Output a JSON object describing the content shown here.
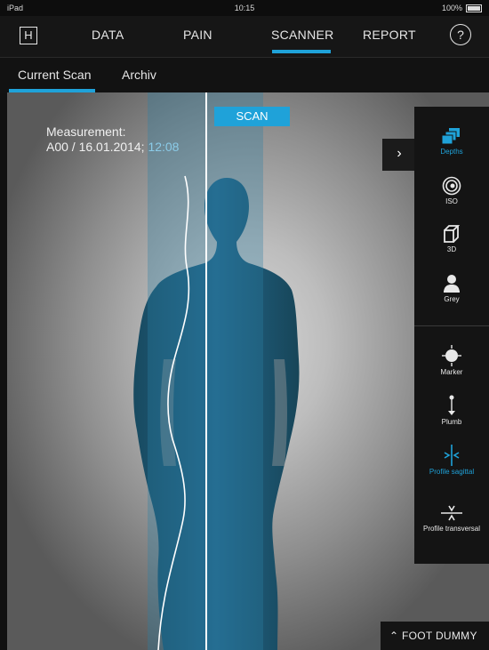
{
  "status_bar": {
    "device": "iPad",
    "time": "10:15",
    "battery": "100%"
  },
  "nav": {
    "logo": "H",
    "tabs": [
      {
        "label": "DATA"
      },
      {
        "label": "PAIN"
      },
      {
        "label": "SCANNER",
        "active": true
      },
      {
        "label": "REPORT"
      }
    ],
    "help": "?"
  },
  "subnav": {
    "tabs": [
      {
        "label": "Current Scan",
        "active": true
      },
      {
        "label": "Archiv"
      }
    ]
  },
  "scan": {
    "measurement_label": "Measurement:",
    "measurement_id": "A00 / 16.01.2014;",
    "measurement_time": "12:08",
    "scan_button": "SCAN"
  },
  "toolbar": {
    "expand": "›",
    "view_tools": [
      {
        "label": "Depths",
        "icon": "depths-icon",
        "active": true
      },
      {
        "label": "ISO",
        "icon": "iso-icon"
      },
      {
        "label": "3D",
        "icon": "cube-icon"
      },
      {
        "label": "Grey",
        "icon": "grey-person-icon"
      }
    ],
    "analysis_tools": [
      {
        "label": "Marker",
        "icon": "marker-icon"
      },
      {
        "label": "Plumb",
        "icon": "plumb-icon"
      },
      {
        "label": "Profile sagittal",
        "icon": "profile-sagittal-icon",
        "active": true
      },
      {
        "label": "Profile transversal",
        "icon": "profile-transversal-icon"
      }
    ]
  },
  "footer": {
    "foot_dummy": "FOOT DUMMY"
  },
  "colors": {
    "accent": "#1fa2d9",
    "body": "#1e5a74",
    "toolbar": "#141414"
  }
}
